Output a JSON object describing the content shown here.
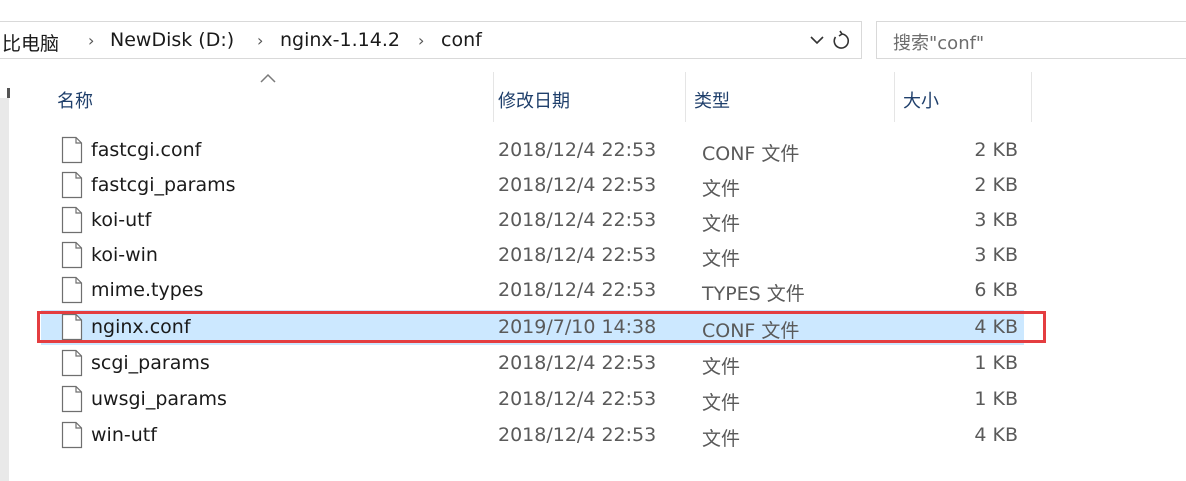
{
  "address_bar": {
    "crumbs": [
      "比电脑",
      "NewDisk (D:)",
      "nginx-1.14.2",
      "conf"
    ],
    "separator": "›"
  },
  "search": {
    "placeholder": "搜索\"conf\""
  },
  "columns": {
    "name": "名称",
    "date": "修改日期",
    "type": "类型",
    "size": "大小"
  },
  "files": [
    {
      "name": "fastcgi.conf",
      "date": "2018/12/4 22:53",
      "type": "CONF 文件",
      "size": "2 KB"
    },
    {
      "name": "fastcgi_params",
      "date": "2018/12/4 22:53",
      "type": "文件",
      "size": "2 KB"
    },
    {
      "name": "koi-utf",
      "date": "2018/12/4 22:53",
      "type": "文件",
      "size": "3 KB"
    },
    {
      "name": "koi-win",
      "date": "2018/12/4 22:53",
      "type": "文件",
      "size": "3 KB"
    },
    {
      "name": "mime.types",
      "date": "2018/12/4 22:53",
      "type": "TYPES 文件",
      "size": "6 KB"
    },
    {
      "name": "nginx.conf",
      "date": "2019/7/10 14:38",
      "type": "CONF 文件",
      "size": "4 KB"
    },
    {
      "name": "scgi_params",
      "date": "2018/12/4 22:53",
      "type": "文件",
      "size": "1 KB"
    },
    {
      "name": "uwsgi_params",
      "date": "2018/12/4 22:53",
      "type": "文件",
      "size": "1 KB"
    },
    {
      "name": "win-utf",
      "date": "2018/12/4 22:53",
      "type": "文件",
      "size": "4 KB"
    }
  ],
  "selected_file": "nginx.conf",
  "colors": {
    "selection": "#cce8ff",
    "highlight_border": "#e43d40",
    "header_text": "#1f3f6b"
  }
}
